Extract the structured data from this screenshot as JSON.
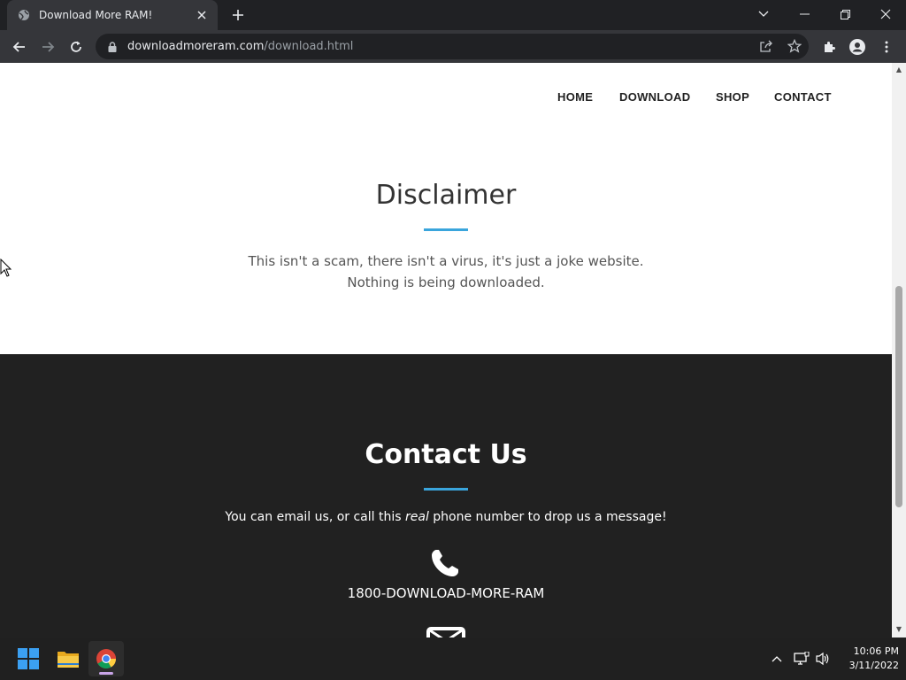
{
  "browser": {
    "tab": {
      "title": "Download More RAM!",
      "favicon": "globe-icon"
    },
    "address": {
      "host": "downloadmoreram.com",
      "path": "/download.html"
    }
  },
  "site": {
    "nav": {
      "home": "HOME",
      "download": "DOWNLOAD",
      "shop": "SHOP",
      "contact": "CONTACT"
    },
    "disclaimer": {
      "title": "Disclaimer",
      "line1": "This isn't a scam, there isn't a virus, it's just a joke website.",
      "line2": "Nothing is being downloaded."
    },
    "contact": {
      "title": "Contact Us",
      "text_before": "You can email us, or call this ",
      "text_emphasis": "real",
      "text_after": " phone number to drop us a message!",
      "phone": "1800-DOWNLOAD-MORE-RAM"
    }
  },
  "taskbar": {
    "time": "10:06 PM",
    "date": "3/11/2022"
  },
  "colors": {
    "accent": "#3aa5dc",
    "dark_section": "#212121",
    "browser_frame": "#202124"
  }
}
